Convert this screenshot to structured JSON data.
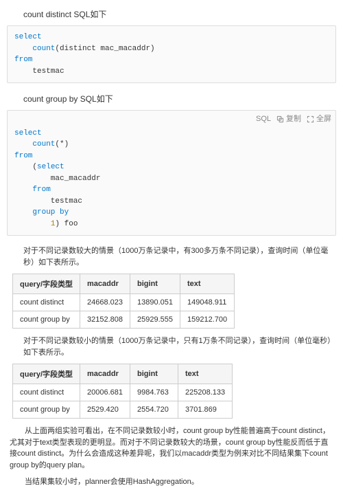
{
  "titles": {
    "t1": "count distinct SQL如下",
    "t2": "count group by SQL如下"
  },
  "toolbar": {
    "lang": "SQL",
    "copy": "复制",
    "fullscreen": "全屏"
  },
  "code1": {
    "l1": "select",
    "l2_kw": "count",
    "l2_rest": "(distinct mac_macaddr)",
    "l3": "from",
    "l4": "    testmac"
  },
  "code2": {
    "l1": "select",
    "l2_kw": "count",
    "l2_rest": "(*)",
    "l3": "from",
    "l4_a": "    (",
    "l4_b": "select",
    "l5": "        mac_macaddr",
    "l6_a": "    ",
    "l6_b": "from",
    "l7": "        testmac",
    "l8_a": "    ",
    "l8_b": "group by",
    "l9_a": "        ",
    "l9_b": "1",
    "l9_c": ") foo"
  },
  "para1": "对于不同记录数较大的情景（1000万条记录中，有300多万条不同记录），查询时间（单位毫秒）如下表所示。",
  "para2": "对于不同记录数较小的情景（1000万条记录中，只有1万条不同记录），查询时间（单位毫秒）如下表所示。",
  "para3": "从上面两组实验可看出，在不同记录数较小时，count group by性能普遍高于count distinct，尤其对于text类型表现的更明显。而对于不同记录数较大的场景，count group by性能反而低于直接count distinct。为什么会造成这种差异呢，我们以macaddr类型为例来对比不同结果集下count group by的query plan。",
  "para4": "当结果集较小时，planner会使用HashAggregation。",
  "table1": {
    "headers": [
      "query/字段类型",
      "macaddr",
      "bigint",
      "text"
    ],
    "rows": [
      {
        "label": "count distinct",
        "c1": "24668.023",
        "c2": "13890.051",
        "c3": "149048.911"
      },
      {
        "label": "count group by",
        "c1": "32152.808",
        "c2": "25929.555",
        "c3": "159212.700"
      }
    ]
  },
  "table2": {
    "headers": [
      "query/字段类型",
      "macaddr",
      "bigint",
      "text"
    ],
    "rows": [
      {
        "label": "count distinct",
        "c1": "20006.681",
        "c2": "9984.763",
        "c3": "225208.133"
      },
      {
        "label": "count group by",
        "c1": "2529.420",
        "c2": "2554.720",
        "c3": "3701.869"
      }
    ]
  }
}
